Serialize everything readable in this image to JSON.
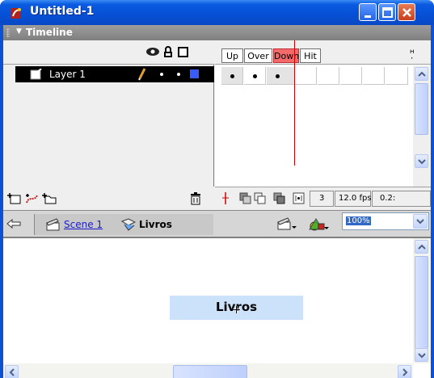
{
  "window": {
    "title": "Untitled-1"
  },
  "timeline": {
    "panel_title": "Timeline",
    "layer": {
      "name": "Layer 1"
    },
    "states": [
      "Up",
      "Over",
      "Down",
      "Hit"
    ],
    "current_frame": "3",
    "frame_rate": "12.0 fps",
    "elapsed_time": "0.2:"
  },
  "editbar": {
    "scene_label": "Scene 1",
    "symbol_label": "Livros",
    "zoom_value": "100%"
  },
  "stage": {
    "button_text": "Livros"
  },
  "colors": {
    "titlebar": "#0650d5",
    "down_highlight": "#f46a6a",
    "layer_color": "#3a5cff",
    "stage_text_bg": "#cce2fb"
  }
}
